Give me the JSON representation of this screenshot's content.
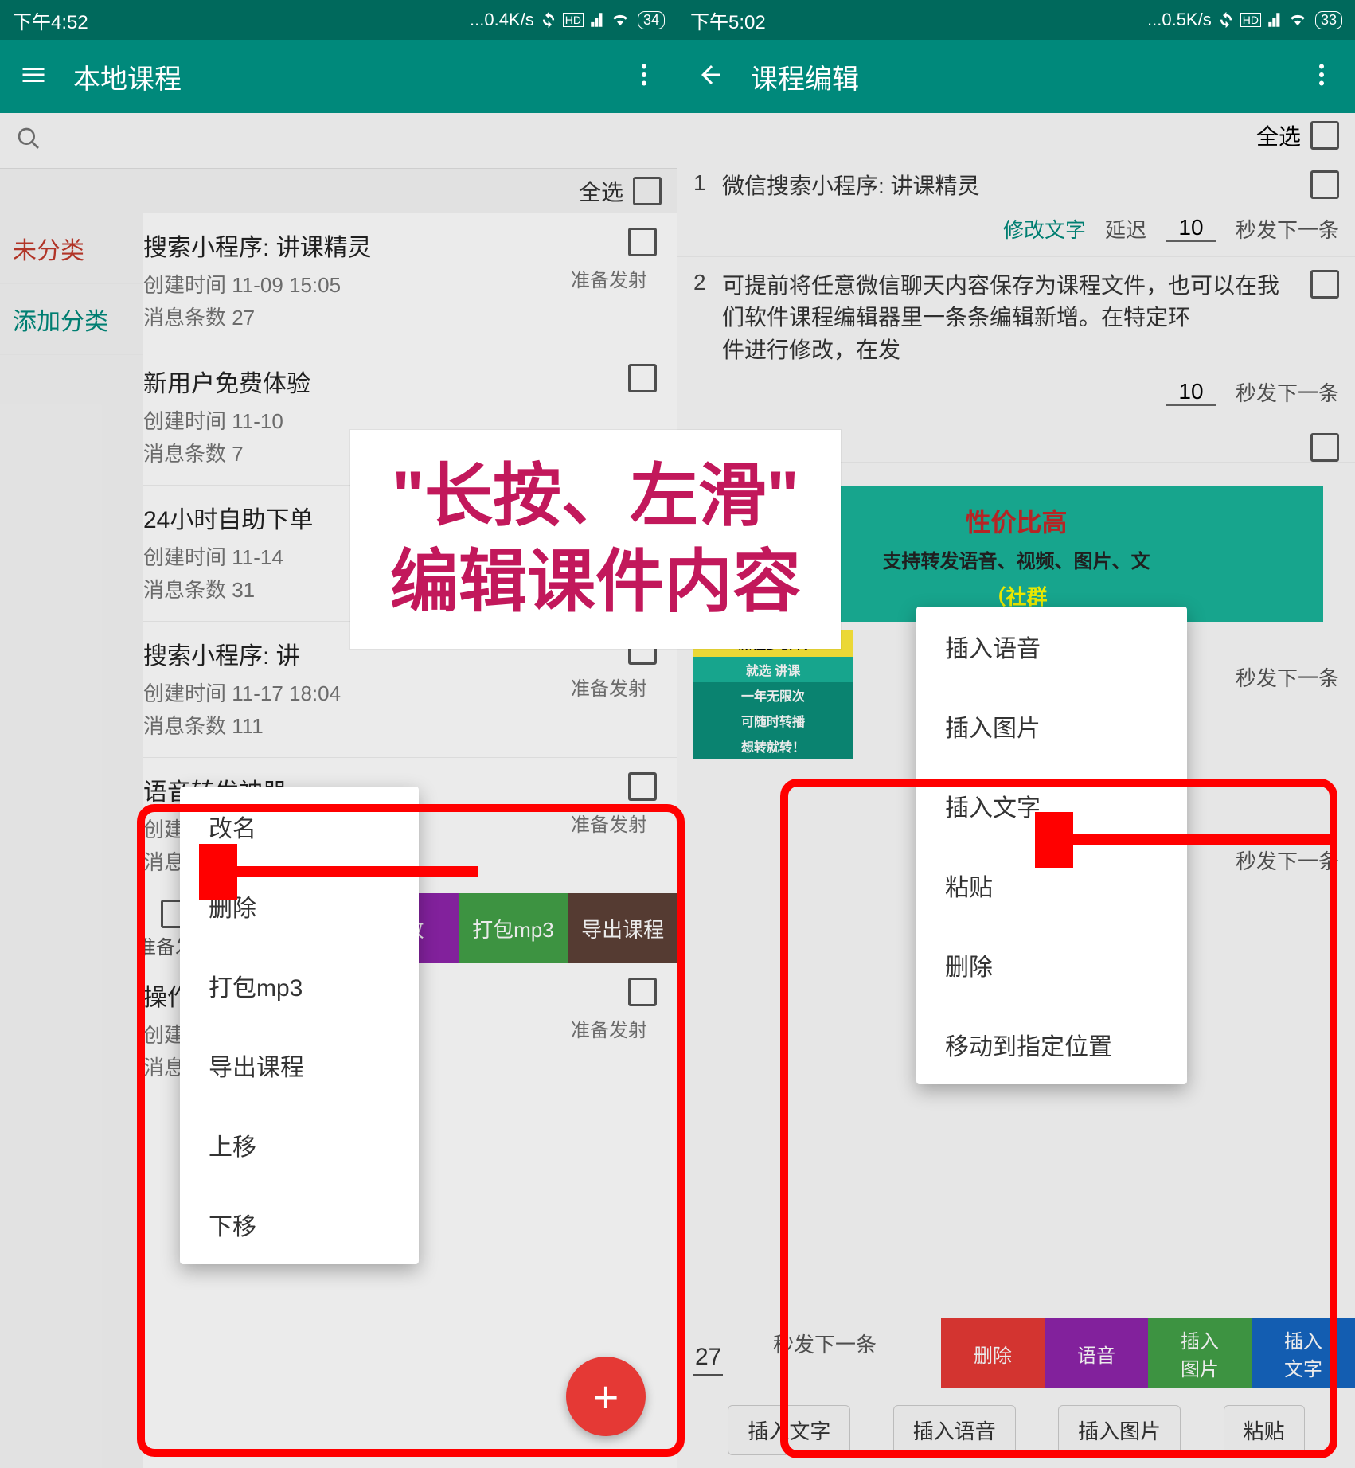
{
  "status": {
    "time_left": "下午4:52",
    "net_left": "...0.4K/s",
    "batt_left": "34",
    "time_right": "下午5:02",
    "net_right": "...0.5K/s",
    "batt_right": "33"
  },
  "left": {
    "title": "本地课程",
    "select_all": "全选",
    "sidebar": {
      "uncat": "未分类",
      "add": "添加分类"
    },
    "ready": "准备发射",
    "items": [
      {
        "title": "搜索小程序: 讲课精灵",
        "created": "创建时间 11-09 15:05",
        "count": "消息条数 27"
      },
      {
        "title": "新用户免费体验",
        "created": "创建时间 11-10",
        "count": "消息条数 7"
      },
      {
        "title": "24小时自助下单",
        "created": "创建时间 11-14",
        "count": "消息条数 31"
      },
      {
        "title": "搜索小程序: 讲",
        "created": "创建时间 11-17 18:04",
        "count": "消息条数 111"
      },
      {
        "title": "语音转发神器",
        "created": "创建时间 11-",
        "count": "消息条数 7"
      },
      {
        "title": "操作",
        "created": "创建",
        "count": "消息"
      }
    ],
    "swipe": {
      "modify": "修改",
      "pack": "打包mp3",
      "export": "导出课程"
    },
    "menu": [
      "改名",
      "删除",
      "打包mp3",
      "导出课程",
      "上移",
      "下移"
    ],
    "fab": "+"
  },
  "right": {
    "title": "课程编辑",
    "select_all": "全选",
    "modify_text": "修改文字",
    "delay": "延迟",
    "delay_val": "10",
    "next_in": "秒发下一条",
    "items": [
      {
        "num": "1",
        "text": "微信搜索小程序: 讲课精灵"
      },
      {
        "num": "2",
        "text": "可提前将任意微信聊天内容保存为课程文件，也可以在我们软件课程编辑器里一条条编辑新增。在特定环　　　　　　　　　　　　　　　件进行修改，在发"
      }
    ],
    "promo": {
      "line2": "性价比高",
      "sub": "支持转发语音、视频、图片、文",
      "sub2": "（社群"
    },
    "promo2": {
      "yl": "课程多群转",
      "gr1": "就选 讲课",
      "gr2": "一年无限次",
      "gr3": "可随时转播",
      "gr4": "想转就转！"
    },
    "menu": [
      "插入语音",
      "插入图片",
      "插入文字",
      "粘贴",
      "删除",
      "移动到指定位置"
    ],
    "bottom_swipe": {
      "del": "删除",
      "voice": "语音",
      "img1": "插入",
      "img2": "图片",
      "txt1": "插入",
      "txt2": "文字"
    },
    "quick": [
      "插入文字",
      "插入语音",
      "插入图片",
      "粘贴"
    ],
    "num27": "27"
  },
  "overlay": {
    "line1": "\"长按、左滑\"",
    "line2": "编辑课件内容"
  }
}
